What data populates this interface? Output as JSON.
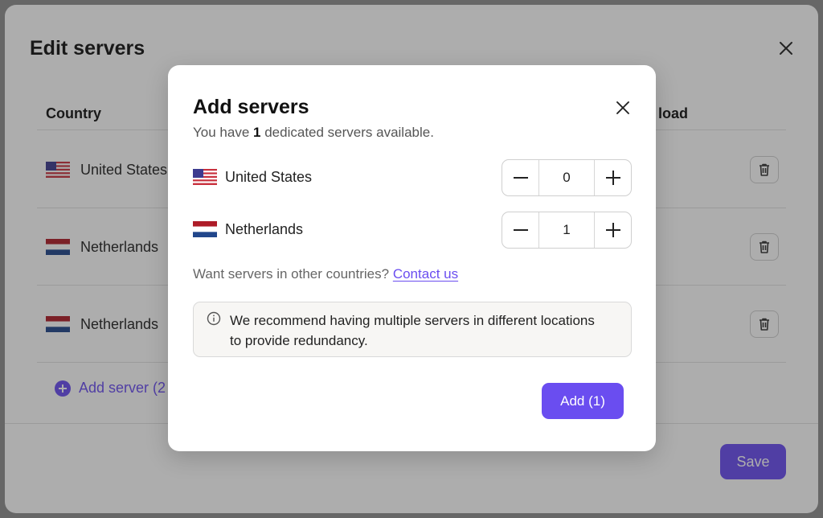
{
  "background_modal": {
    "title": "Edit servers",
    "columns": {
      "country": "Country",
      "load": "load"
    },
    "rows": [
      {
        "country": "United States",
        "flag": "us-flag-icon"
      },
      {
        "country": "Netherlands",
        "flag": "nl-flag-icon"
      },
      {
        "country": "Netherlands",
        "flag": "nl-flag-icon"
      }
    ],
    "add_server_label": "Add server (2",
    "save_label": "Save"
  },
  "dialog": {
    "title": "Add servers",
    "subtitle_prefix": "You have",
    "available_count": "1",
    "subtitle_suffix": "dedicated servers available.",
    "servers": [
      {
        "country": "United States",
        "flag": "us-flag-icon",
        "quantity": "0"
      },
      {
        "country": "Netherlands",
        "flag": "nl-flag-icon",
        "quantity": "1"
      }
    ],
    "contact_prompt": "Want servers in other countries?",
    "contact_link": "Contact us",
    "info_text": "We recommend having multiple servers in different locations to provide redundancy.",
    "add_button_label": "Add (1)"
  },
  "colors": {
    "accent": "#6a4df0",
    "overlay": "rgba(40,40,40,0.38)"
  }
}
